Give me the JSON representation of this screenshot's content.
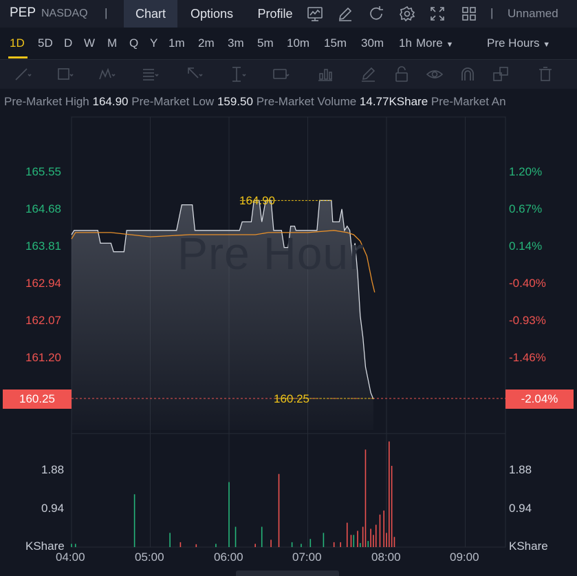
{
  "header": {
    "symbol": "PEP",
    "exchange": "NASDAQ",
    "separator": "|",
    "tabs": [
      {
        "label": "Chart",
        "active": true
      },
      {
        "label": "Options",
        "active": false
      },
      {
        "label": "Profile",
        "active": false
      }
    ],
    "icons": [
      "chart-type-icon",
      "draw-icon",
      "refresh-icon",
      "settings-icon",
      "fullscreen-icon",
      "layout-grid-icon"
    ],
    "layout_name": "Unnamed"
  },
  "timeframes": {
    "items": [
      "1D",
      "5D",
      "D",
      "W",
      "M",
      "Q",
      "Y",
      "1m",
      "2m",
      "3m",
      "5m",
      "10m",
      "15m",
      "30m",
      "1h"
    ],
    "active": "1D",
    "more_label": "More",
    "session_label": "Pre Hours"
  },
  "tools": [
    "trendline-tool-icon",
    "rectangle-tool-icon",
    "pattern-tool-icon",
    "fib-tool-icon",
    "arrow-tool-icon",
    "measure-tool-icon",
    "text-tool-icon",
    "indicator-tool-icon",
    "brush-tool-icon",
    "lock-icon",
    "eye-icon",
    "magnet-icon",
    "layers-icon",
    "trash-icon"
  ],
  "info": {
    "high_label": "Pre-Market High",
    "high_value": "164.90",
    "low_label": "Pre-Market Low",
    "low_value": "159.50",
    "volume_label": "Pre-Market Volume",
    "volume_value": "14.77KShare",
    "amount_label": "Pre-Market An"
  },
  "chart": {
    "watermark": "Pre Hour",
    "high_marker": "164.90",
    "last_marker": "160.25",
    "last_price_tag": "160.25",
    "last_pct_tag": "-2.04%"
  },
  "chart_data": {
    "type": "line",
    "price_axis": {
      "ticks": [
        "165.55",
        "164.68",
        "163.81",
        "162.94",
        "162.07",
        "161.20"
      ],
      "values": [
        165.55,
        164.68,
        163.81,
        162.94,
        162.07,
        161.2
      ]
    },
    "pct_axis": {
      "ticks": [
        "1.20%",
        "0.67%",
        "0.14%",
        "-0.40%",
        "-0.93%",
        "-1.46%"
      ]
    },
    "volume_axis": {
      "ticks": [
        "1.88",
        "0.94"
      ],
      "unit": "KShare"
    },
    "x_ticks": [
      "04:00",
      "05:00",
      "06:00",
      "07:00",
      "08:00",
      "09:00"
    ],
    "x_range_minutes": [
      0,
      300
    ],
    "prev_close": 163.58,
    "colors": {
      "up": "#26b67a",
      "down": "#ef5350",
      "price_line": "#d7dbe2",
      "avg_line": "#e8902a",
      "accent": "#f0c419"
    },
    "price_series": [
      [
        0,
        164.1
      ],
      [
        2,
        164.2
      ],
      [
        20,
        164.2
      ],
      [
        22,
        163.9
      ],
      [
        30,
        163.9
      ],
      [
        32,
        163.7
      ],
      [
        40,
        163.7
      ],
      [
        42,
        164.2
      ],
      [
        50,
        164.2
      ],
      [
        52,
        164.2
      ],
      [
        80,
        164.2
      ],
      [
        82,
        164.5
      ],
      [
        84,
        164.8
      ],
      [
        92,
        164.8
      ],
      [
        94,
        164.2
      ],
      [
        110,
        164.2
      ],
      [
        128,
        164.2
      ],
      [
        130,
        164.4
      ],
      [
        137,
        164.4
      ],
      [
        139,
        164.9
      ],
      [
        143,
        164.9
      ],
      [
        145,
        164.4
      ],
      [
        148,
        164.9
      ],
      [
        152,
        164.9
      ],
      [
        154,
        164.2
      ],
      [
        160,
        164.2
      ],
      [
        162,
        163.8
      ],
      [
        165,
        163.8
      ],
      [
        167,
        164.3
      ],
      [
        170,
        164.3
      ],
      [
        171,
        164.2
      ],
      [
        180,
        164.2
      ],
      [
        187,
        164.2
      ],
      [
        189,
        164.9
      ],
      [
        194,
        164.9
      ],
      [
        198,
        164.9
      ],
      [
        199,
        164.4
      ],
      [
        204,
        164.4
      ],
      [
        206,
        164.7
      ],
      [
        208,
        164.2
      ],
      [
        210,
        164.3
      ],
      [
        212,
        164.2
      ],
      [
        214,
        163.6
      ],
      [
        216,
        163.9
      ],
      [
        218,
        163.2
      ],
      [
        220,
        162.2
      ],
      [
        222,
        161.7
      ],
      [
        224,
        161.0
      ],
      [
        226,
        160.7
      ],
      [
        228,
        160.4
      ],
      [
        230,
        160.25
      ]
    ],
    "avg_series": [
      [
        0,
        164.0
      ],
      [
        3,
        164.15
      ],
      [
        30,
        164.15
      ],
      [
        45,
        164.1
      ],
      [
        60,
        164.05
      ],
      [
        90,
        164.1
      ],
      [
        120,
        164.1
      ],
      [
        140,
        164.1
      ],
      [
        150,
        164.15
      ],
      [
        180,
        164.15
      ],
      [
        200,
        164.2
      ],
      [
        210,
        164.15
      ],
      [
        215,
        164.1
      ],
      [
        220,
        163.95
      ],
      [
        225,
        163.6
      ],
      [
        229,
        163.0
      ],
      [
        231,
        162.75
      ]
    ],
    "volume_series": [
      [
        0,
        0.08,
        "g"
      ],
      [
        3,
        0.08,
        "g"
      ],
      [
        48,
        1.3,
        "g"
      ],
      [
        75,
        0.35,
        "g"
      ],
      [
        83,
        0.12,
        "r"
      ],
      [
        95,
        0.07,
        "r"
      ],
      [
        110,
        0.08,
        "g"
      ],
      [
        120,
        1.6,
        "g"
      ],
      [
        125,
        0.5,
        "g"
      ],
      [
        140,
        0.08,
        "r"
      ],
      [
        145,
        0.5,
        "g"
      ],
      [
        152,
        0.18,
        "r"
      ],
      [
        158,
        1.8,
        "r"
      ],
      [
        168,
        0.12,
        "g"
      ],
      [
        175,
        0.08,
        "g"
      ],
      [
        182,
        0.2,
        "g"
      ],
      [
        192,
        0.35,
        "g"
      ],
      [
        200,
        0.12,
        "r"
      ],
      [
        205,
        0.12,
        "r"
      ],
      [
        210,
        0.6,
        "r"
      ],
      [
        213,
        0.3,
        "r"
      ],
      [
        215,
        0.3,
        "g"
      ],
      [
        218,
        0.4,
        "r"
      ],
      [
        220,
        0.1,
        "g"
      ],
      [
        222,
        0.5,
        "r"
      ],
      [
        224,
        2.4,
        "r"
      ],
      [
        226,
        0.15,
        "g"
      ],
      [
        228,
        0.45,
        "r"
      ],
      [
        230,
        0.3,
        "r"
      ],
      [
        232,
        0.55,
        "r"
      ],
      [
        235,
        0.8,
        "r"
      ],
      [
        238,
        0.9,
        "r"
      ],
      [
        240,
        0.35,
        "r"
      ],
      [
        242,
        2.6,
        "r"
      ],
      [
        244,
        2.0,
        "r"
      ],
      [
        246,
        0.25,
        "r"
      ]
    ],
    "volume_max": 2.82
  }
}
